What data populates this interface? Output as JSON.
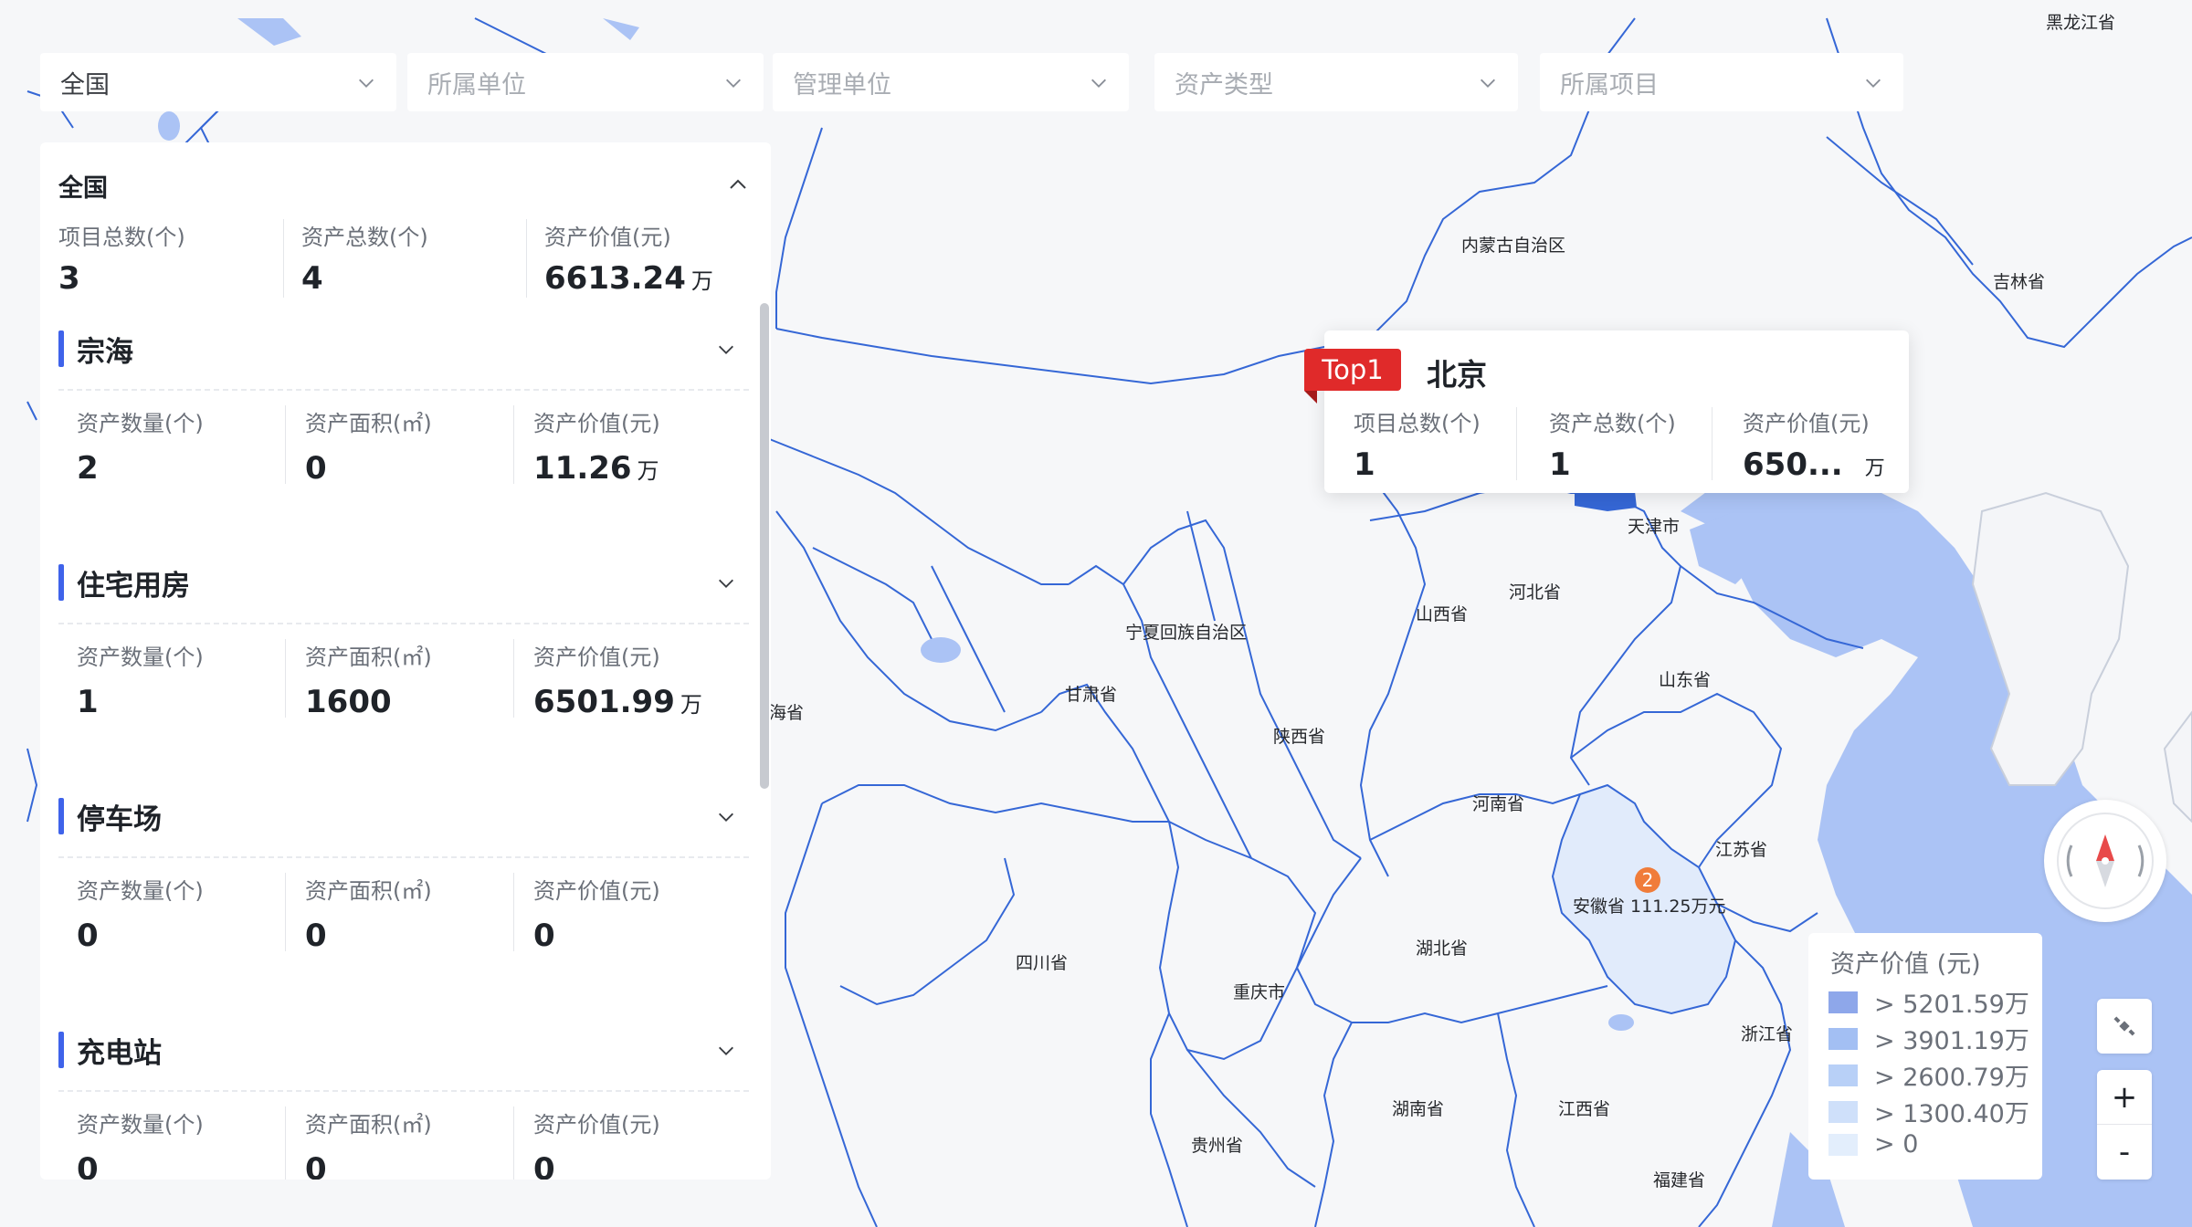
{
  "filters": {
    "region": "全国",
    "unit": "所属单位",
    "manager": "管理单位",
    "asset_type": "资产类型",
    "project": "所属项目"
  },
  "panel": {
    "title": "全国",
    "summary": [
      {
        "label": "项目总数(个)",
        "value": "3",
        "unit": ""
      },
      {
        "label": "资产总数(个)",
        "value": "4",
        "unit": ""
      },
      {
        "label": "资产价值(元)",
        "value": "6613.24",
        "unit": "万"
      }
    ],
    "categories": [
      {
        "name": "宗海",
        "metrics": [
          {
            "label": "资产数量(个)",
            "value": "2",
            "unit": ""
          },
          {
            "label": "资产面积(㎡)",
            "value": "0",
            "unit": ""
          },
          {
            "label": "资产价值(元)",
            "value": "11.26",
            "unit": "万"
          }
        ]
      },
      {
        "name": "住宅用房",
        "metrics": [
          {
            "label": "资产数量(个)",
            "value": "1",
            "unit": ""
          },
          {
            "label": "资产面积(㎡)",
            "value": "1600",
            "unit": ""
          },
          {
            "label": "资产价值(元)",
            "value": "6501.99",
            "unit": "万"
          }
        ]
      },
      {
        "name": "停车场",
        "metrics": [
          {
            "label": "资产数量(个)",
            "value": "0",
            "unit": ""
          },
          {
            "label": "资产面积(㎡)",
            "value": "0",
            "unit": ""
          },
          {
            "label": "资产价值(元)",
            "value": "0",
            "unit": ""
          }
        ]
      },
      {
        "name": "充电站",
        "metrics": [
          {
            "label": "资产数量(个)",
            "value": "0",
            "unit": ""
          },
          {
            "label": "资产面积(㎡)",
            "value": "0",
            "unit": ""
          },
          {
            "label": "资产价值(元)",
            "value": "0",
            "unit": ""
          }
        ]
      }
    ]
  },
  "tooltip": {
    "badge": "Top1",
    "city": "北京",
    "stats": [
      {
        "label": "项目总数(个)",
        "value": "1",
        "unit": ""
      },
      {
        "label": "资产总数(个)",
        "value": "1",
        "unit": ""
      },
      {
        "label": "资产价值(元)",
        "value": "650...",
        "unit": "万"
      }
    ]
  },
  "map": {
    "provinces": [
      "黑龙江省",
      "内蒙古自治区",
      "吉林省",
      "天津市",
      "河北省",
      "山西省",
      "宁夏回族自治区",
      "甘肃省",
      "陕西省",
      "山东省",
      "河南省",
      "江苏省",
      "安徽省",
      "四川省",
      "湖北省",
      "重庆市",
      "浙江省",
      "湖南省",
      "江西省",
      "贵州省",
      "福建省",
      "青海省"
    ],
    "provinces_display": [
      "黑龙江省",
      "内蒙古自治区",
      "吉林省",
      "天津市",
      "河北省",
      "山西省",
      "宁夏回族自治区",
      "甘肃省",
      "陕西省",
      "山东省",
      "河南省",
      "江苏省",
      "安徽省 111.25万元",
      "四川省",
      "湖北省",
      "重庆市",
      "浙江省",
      "湖南省",
      "江西省",
      "贵州省",
      "福建省",
      "海省"
    ],
    "highlighted": [
      {
        "province": "安徽省",
        "value_label": "111.25万元",
        "marker": "2"
      }
    ],
    "sea_color": "#abc3f5",
    "land_color": "#f4f5f8",
    "border_color": "#3567d6"
  },
  "legend": {
    "title": "资产价值 (元)",
    "items": [
      {
        "label": "> 5201.59万",
        "color": "#8ea7ea"
      },
      {
        "label": "> 3901.19万",
        "color": "#a3bff3"
      },
      {
        "label": "> 2600.79万",
        "color": "#b8d0f7"
      },
      {
        "label": "> 1300.40万",
        "color": "#cfe0fa"
      },
      {
        "label": "> 0",
        "color": "#e3eefc"
      }
    ]
  },
  "controls": {
    "zoom_in": "+",
    "zoom_out": "-"
  }
}
